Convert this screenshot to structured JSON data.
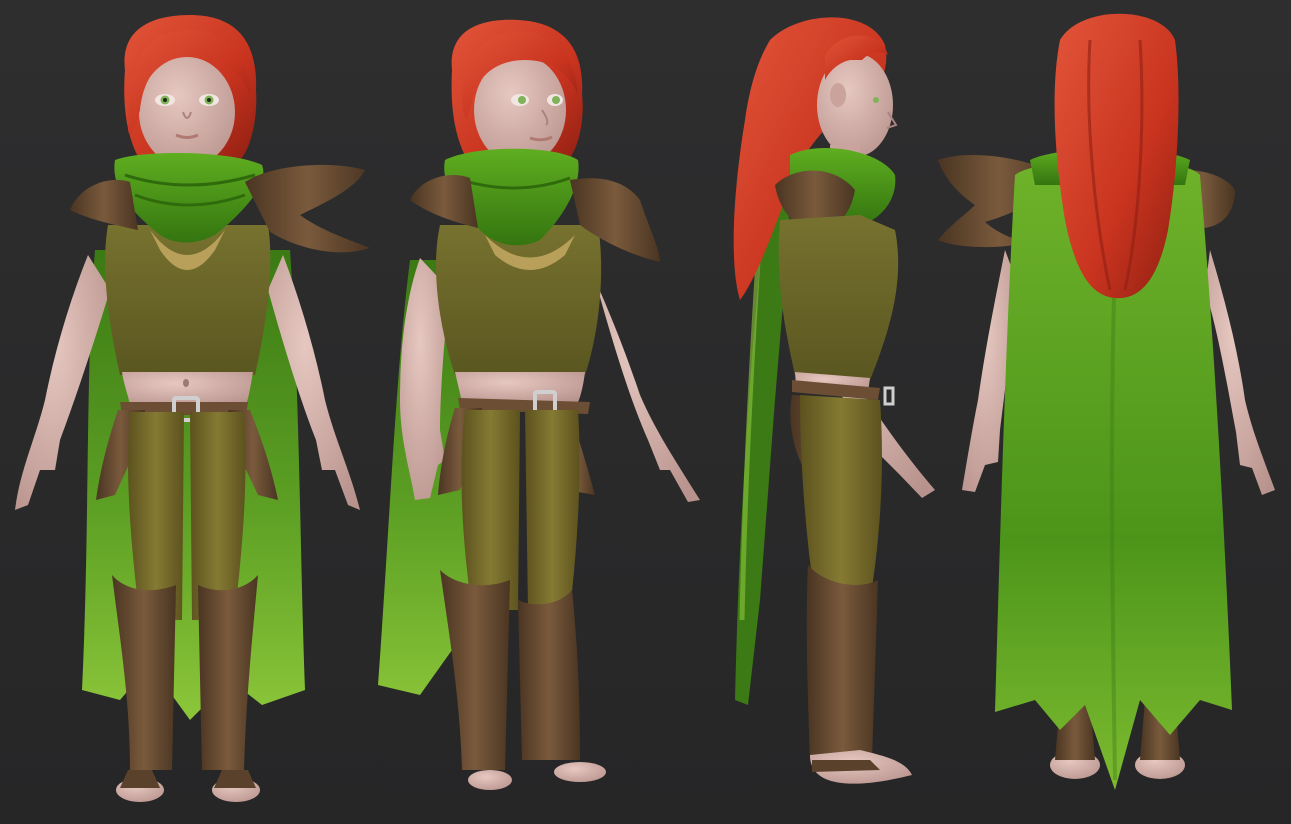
{
  "scene": {
    "views": [
      {
        "view": "front"
      },
      {
        "view": "three-quarter"
      },
      {
        "view": "side"
      },
      {
        "view": "back"
      }
    ]
  },
  "palette": {
    "background": "#2b2b2c",
    "skin": "#d7b3ac",
    "skin_shadow": "#a8837f",
    "hair": "#c9341f",
    "hair_dark": "#8f1f12",
    "hair_light": "#e2553a",
    "scarf": "#4f9a18",
    "scarf_dark": "#2f6b0c",
    "cape_light": "#8cc63a",
    "cape_dark": "#3b7a14",
    "tunic": "#6e6a2c",
    "tunic_dark": "#4e4a1c",
    "inset": "#b9a05a",
    "leather": "#6b4e33",
    "leather_dark": "#4a3522",
    "pants": "#7a6e2c",
    "pants_dark": "#54491a",
    "buckle": "#cfcfcf",
    "eye": "#7fb25a"
  }
}
